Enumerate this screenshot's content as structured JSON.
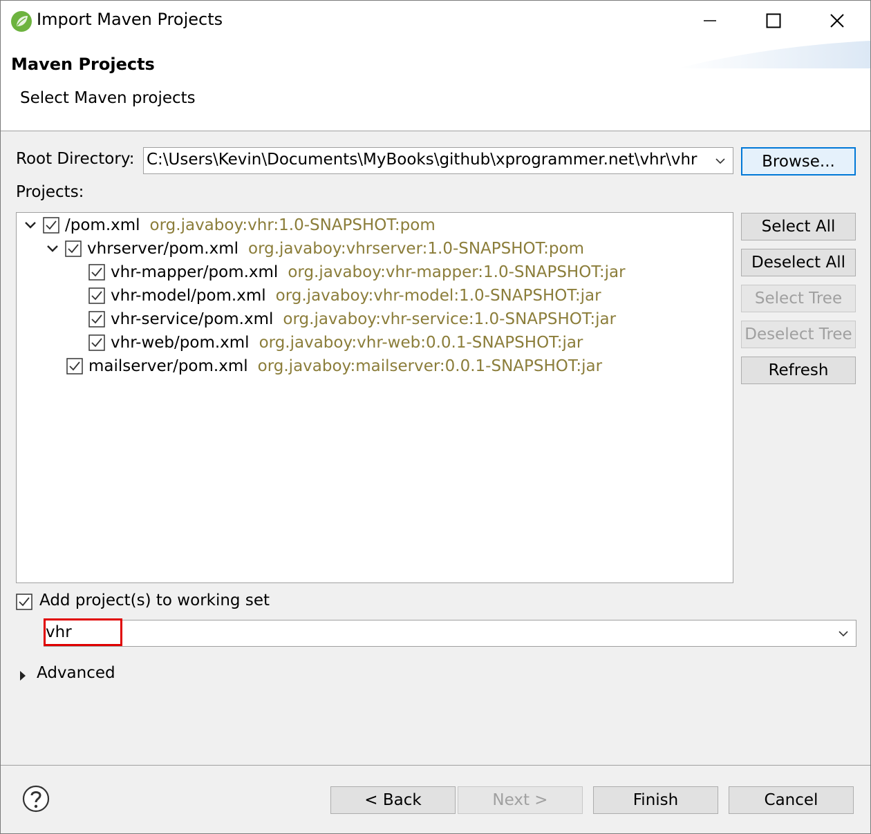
{
  "window": {
    "title": "Import Maven Projects",
    "icon": "spring-leaf-icon",
    "controls": [
      "minimize-icon",
      "maximize-icon",
      "close-icon"
    ]
  },
  "banner": {
    "title": "Maven Projects",
    "subtitle": "Select Maven projects"
  },
  "root": {
    "label": "Root Directory:",
    "value": "C:\\Users\\Kevin\\Documents\\MyBooks\\github\\xprogrammer.net\\vhr\\vhr",
    "browse_label": "Browse..."
  },
  "projects": {
    "label": "Projects:",
    "items": [
      {
        "path": "/pom.xml",
        "coords": "org.javaboy:vhr:1.0-SNAPSHOT:pom",
        "checked": true,
        "expanded": true,
        "depth": 0
      },
      {
        "path": "vhrserver/pom.xml",
        "coords": "org.javaboy:vhrserver:1.0-SNAPSHOT:pom",
        "checked": true,
        "expanded": true,
        "depth": 1
      },
      {
        "path": "vhr-mapper/pom.xml",
        "coords": "org.javaboy:vhr-mapper:1.0-SNAPSHOT:jar",
        "checked": true,
        "depth": 2
      },
      {
        "path": "vhr-model/pom.xml",
        "coords": "org.javaboy:vhr-model:1.0-SNAPSHOT:jar",
        "checked": true,
        "depth": 2
      },
      {
        "path": "vhr-service/pom.xml",
        "coords": "org.javaboy:vhr-service:1.0-SNAPSHOT:jar",
        "checked": true,
        "depth": 2
      },
      {
        "path": "vhr-web/pom.xml",
        "coords": "org.javaboy:vhr-web:0.0.1-SNAPSHOT:jar",
        "checked": true,
        "depth": 2
      },
      {
        "path": "mailserver/pom.xml",
        "coords": "org.javaboy:mailserver:0.0.1-SNAPSHOT:jar",
        "checked": true,
        "depth": 1
      }
    ]
  },
  "side_buttons": {
    "select_all": "Select All",
    "deselect_all": "Deselect All",
    "select_tree": "Select Tree",
    "deselect_tree": "Deselect Tree",
    "refresh": "Refresh"
  },
  "working_set": {
    "label": "Add project(s) to working set",
    "checked": true,
    "value": "vhr"
  },
  "advanced": {
    "label": "Advanced"
  },
  "footer": {
    "help_icon": "help-icon",
    "back": "< Back",
    "next": "Next >",
    "finish": "Finish",
    "cancel": "Cancel"
  },
  "colors": {
    "coordinates": "#8b7d3a",
    "focus_border": "#0078d7",
    "highlight": "#e00000"
  }
}
